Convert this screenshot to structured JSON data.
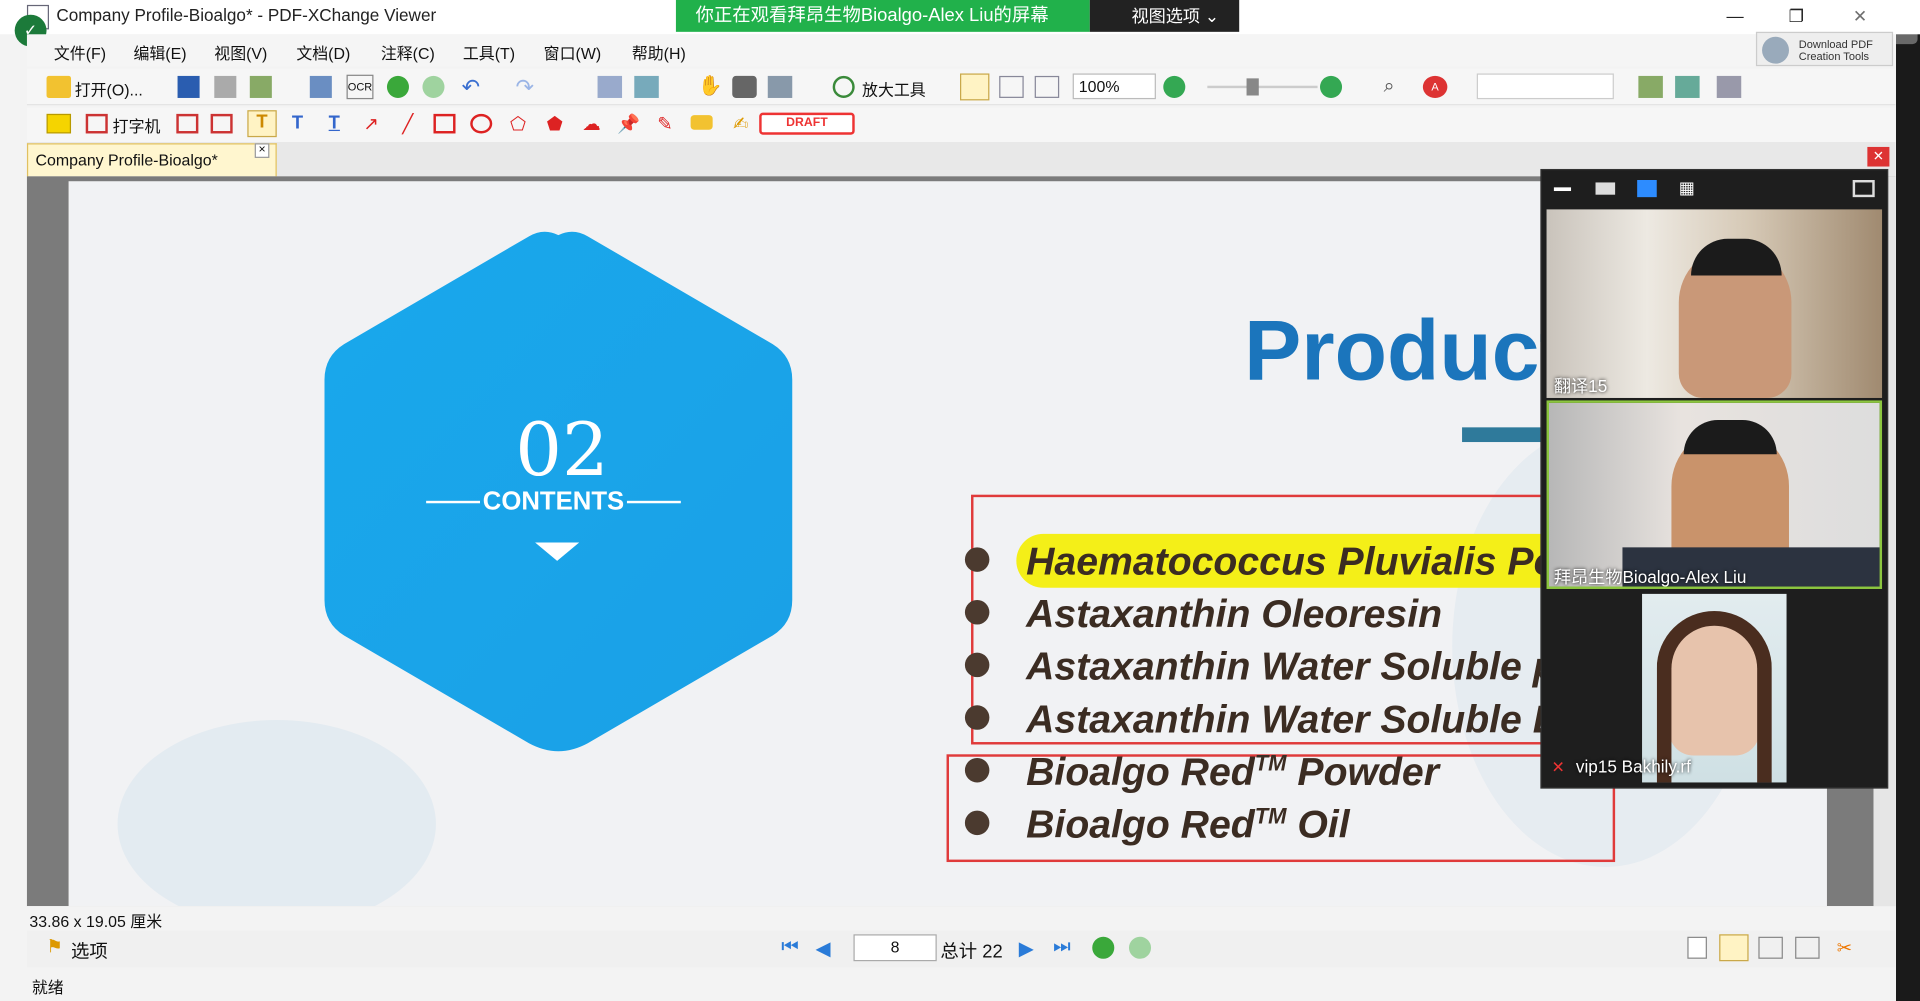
{
  "window": {
    "title": "Company Profile-Bioalgo* - PDF-XChange Viewer",
    "share_banner": "你正在观看拜昂生物Bioalgo-Alex  Liu的屏幕",
    "view_options": "视图选项",
    "view_toggle": "视图",
    "download_pdf": "Download PDF Creation Tools"
  },
  "menu": [
    "文件(F)",
    "编辑(E)",
    "视图(V)",
    "文档(D)",
    "注释(C)",
    "工具(T)",
    "窗口(W)",
    "帮助(H)"
  ],
  "toolbar": {
    "open_label": "打开(O)...",
    "zoom_tool_label": "放大工具",
    "zoom_value": "100%",
    "typewriter_label": "打字机",
    "draft_stamp": "DRAFT",
    "ocr_label": "OCR"
  },
  "tab": {
    "label": "Company Profile-Bioalgo*"
  },
  "slide": {
    "section_number": "02",
    "section_label": "CONTENTS",
    "title": "Product",
    "items": [
      "Haematococcus Pluvialis Pov",
      "Astaxanthin Oleoresin",
      "Astaxanthin Water Soluble p",
      "Astaxanthin Water Soluble L",
      "Bioalgo Red",
      "Bioalgo Red"
    ],
    "item_suffixes": [
      "",
      "",
      "",
      "",
      " Powder",
      " Oil"
    ],
    "trademark": "TM"
  },
  "status": {
    "page_size": "33.86 x 19.05 厘米",
    "options_label": "选项",
    "current_page": "8",
    "total_pages": "总计 22",
    "ready": "就绪"
  },
  "video": {
    "participants": [
      {
        "name": "翻译15"
      },
      {
        "name": "拜昂生物Bioalgo-Alex Liu"
      },
      {
        "name": "vip15  Bakhily.rf"
      }
    ]
  },
  "colors": {
    "banner": "#21b14b",
    "hex": "#19a8ec",
    "title": "#1b75bc",
    "highlight": "#f4ef18",
    "redbox": "#e03a3a"
  }
}
